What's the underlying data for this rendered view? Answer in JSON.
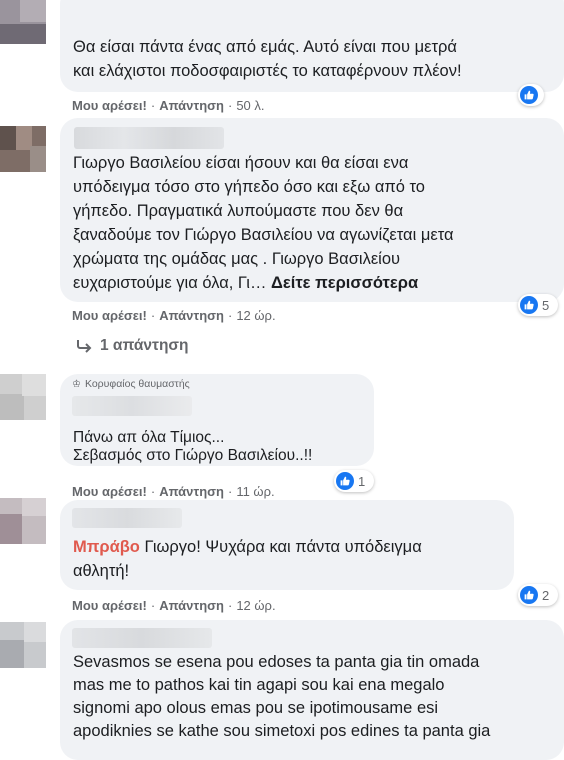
{
  "comments": [
    {
      "lines": [
        "Θα είσαι πάντα ένας από εμάς. Αυτό είναι που μετρά",
        "και ελάχιστοι ποδοσφαιριστές το καταφέρνουν πλέον!"
      ],
      "like_label": "Μου αρέσει!",
      "reply_label": "Απάντηση",
      "time": "50 λ.",
      "reactions": ""
    },
    {
      "lines": [
        "Γιωργο Βασιλείου είσαι ήσουν και θα είσαι ενα",
        "υπόδειγμα τόσο στο γήπεδο όσο και εξω από το",
        "γήπεδο. Πραγματικά λυπούμαστε που δεν θα",
        "ξαναδούμε τον Γιώργο Βασιλείου να αγωνίζεται μετα",
        "χρώματα της ομάδας μας . Γιωργο Βασιλείου"
      ],
      "last_line": "ευχαριστούμε για όλα, Γι… ",
      "see_more": "Δείτε περισσότερα",
      "like_label": "Μου αρέσει!",
      "reply_label": "Απάντηση",
      "time": "12 ώρ.",
      "reactions": "5",
      "replies_label": "1 απάντηση"
    },
    {
      "badge": "Κορυφαίος θαυμαστής",
      "lines": [
        "Πάνω απ όλα Τίμιος...",
        "Σεβασμός στο Γιώργο Βασιλείου..!!"
      ],
      "like_label": "Μου αρέσει!",
      "reply_label": "Απάντηση",
      "time": "11 ώρ.",
      "reactions": "1"
    },
    {
      "highlight": "Μπράβο",
      "first_rest": " Γιωργο! Ψυχάρα και πάντα υπόδειγμα",
      "lines": [
        "αθλητή!"
      ],
      "like_label": "Μου αρέσει!",
      "reply_label": "Απάντηση",
      "time": "12 ώρ.",
      "reactions": "2"
    },
    {
      "lines": [
        "Sevasmos se esena pou edoses ta panta gia tin omada",
        "mas me to pathos kai tin agapi sou kai ena megalo",
        "signomi apo olous emas pou se ipotimousame esi",
        "apodiknies se kathe sou simetoxi pos edines ta panta gia"
      ]
    }
  ],
  "colors": {
    "bubble": "#f0f2f5",
    "like_blue": "#1877f2",
    "meta_gray": "#65676b",
    "mention": "#e05a4e"
  },
  "icons": [
    "like-icon",
    "reply-arrow-icon",
    "top-fan-icon"
  ]
}
